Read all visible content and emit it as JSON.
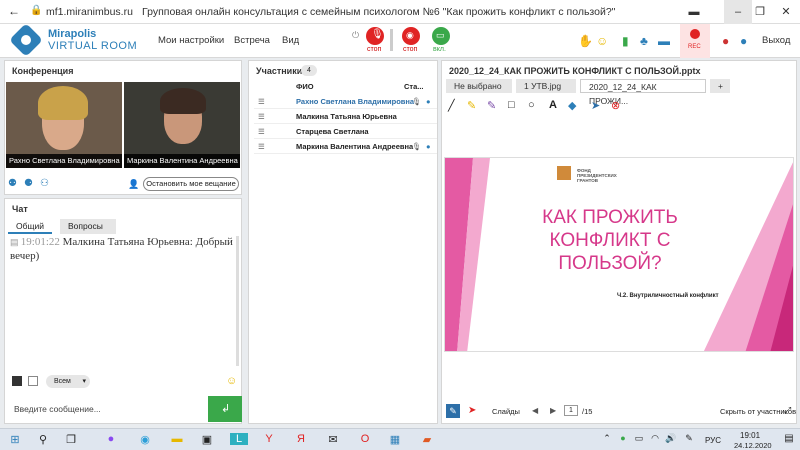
{
  "browser": {
    "url": "mf1.miranimbus.ru",
    "title": "Групповая онлайн консультация с семейным психологом №6 \"Как прожить конфликт с пользой?\""
  },
  "logo": {
    "line1": "Mirapolis",
    "line2": "VIRTUAL ROOM"
  },
  "menu": {
    "settings": "Мои настройки",
    "meeting": "Встреча",
    "view": "Вид",
    "exit": "Выход"
  },
  "toolbar": {
    "mic_label": "стоп",
    "cam_label": "стоп",
    "share_label": "вкл.",
    "rec_label": "REC"
  },
  "conference": {
    "title": "Конференция",
    "videos": [
      {
        "name": "Рахно Светлана  Владимировна"
      },
      {
        "name": "Маркина Валентина  Андреевна"
      }
    ],
    "stop_btn": "Остановить мое вещание"
  },
  "chat": {
    "title": "Чат",
    "tabs": [
      "Общий",
      "Вопросы"
    ],
    "message": {
      "time": "19:01:22",
      "author": "Малкина Татьяна  Юрьевна:",
      "text": "Добрый вечер)"
    },
    "recipient": "Всем",
    "input_placeholder": "Введите сообщение..."
  },
  "participants": {
    "title": "Участники",
    "count": "4",
    "col_name": "ФИО",
    "col_status": "Ста...",
    "rows": [
      {
        "name": "Рахно Светлана  Владимировна",
        "color": "#2d6fa8"
      },
      {
        "name": "Малкина Татьяна  Юрьевна",
        "color": "#222222"
      },
      {
        "name": "Старцева  Светлана",
        "color": "#222222"
      },
      {
        "name": "Маркина Валентина  Андреевна",
        "color": "#222222"
      }
    ]
  },
  "presentation": {
    "filename": "2020_12_24_КАК ПРОЖИТЬ КОНФЛИКТ С ПОЛЬЗОЙ.pptx",
    "tabs": [
      "Не выбрано",
      "1 УТВ.jpg",
      "2020_12_24_КАК ПРОЖИ...",
      "+"
    ],
    "slide": {
      "title": "КАК ПРОЖИТЬ КОНФЛИКТ С ПОЛЬЗОЙ?",
      "subtitle": "Ч.2. Внутриличностный конфликт",
      "fund": "ФОНД ПРЕЗИДЕНТСКИХ ГРАНТОВ"
    },
    "footer": {
      "slides_label": "Слайды",
      "page": "1",
      "total": "/15",
      "hide_label": "Скрыть от участников"
    }
  },
  "taskbar": {
    "lang": "РУС",
    "time": "19:01",
    "date": "24.12.2020"
  },
  "colors": {
    "accent": "#2d7fb8",
    "slide_pink": "#d6388a",
    "green": "#3aa84a",
    "red": "#e02424"
  }
}
